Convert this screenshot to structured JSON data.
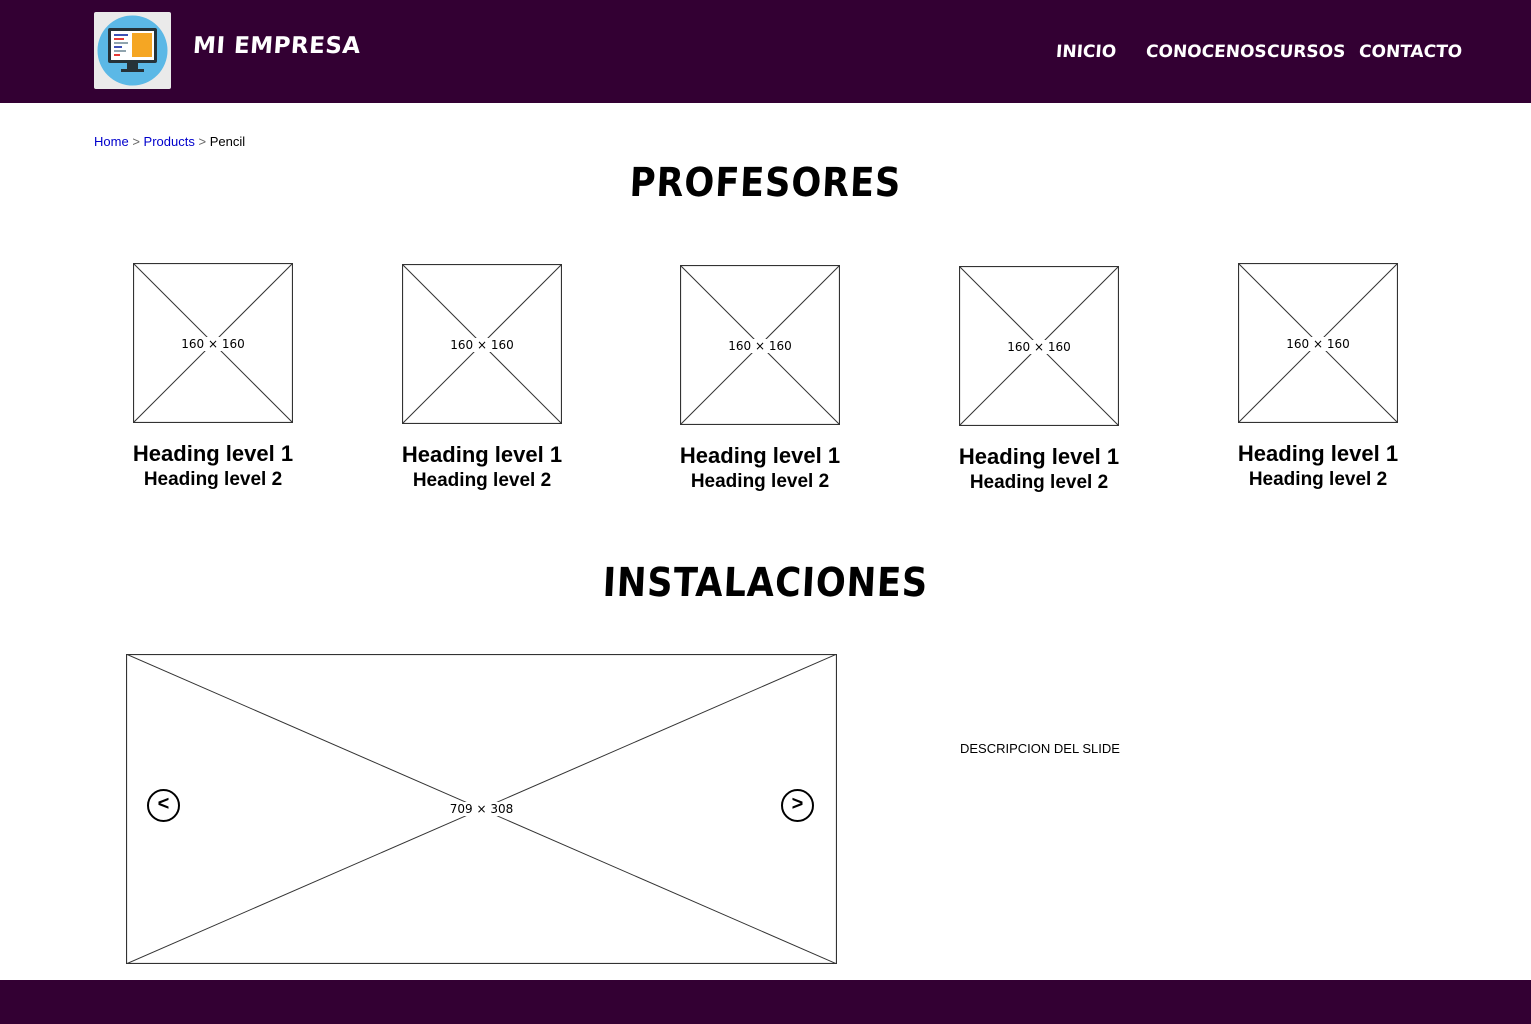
{
  "header": {
    "brand": "MI EMPRESA",
    "logo_icon": "monitor-icon",
    "background": "#330033",
    "nav": [
      {
        "label": "INICIO"
      },
      {
        "label": "CONOCENOS"
      },
      {
        "label": "CURSOS"
      },
      {
        "label": "CONTACTO"
      }
    ]
  },
  "breadcrumb": {
    "items": [
      "Home",
      "Products",
      "Pencil"
    ],
    "separator": ">"
  },
  "profesores": {
    "title": "PROFESORES",
    "cards": [
      {
        "placeholder": "160 × 160",
        "heading1": "Heading level 1",
        "heading2": "Heading level 2"
      },
      {
        "placeholder": "160 × 160",
        "heading1": "Heading level 1",
        "heading2": "Heading level 2"
      },
      {
        "placeholder": "160 × 160",
        "heading1": "Heading level 1",
        "heading2": "Heading level 2"
      },
      {
        "placeholder": "160 × 160",
        "heading1": "Heading level 1",
        "heading2": "Heading level 2"
      },
      {
        "placeholder": "160 × 160",
        "heading1": "Heading level 1",
        "heading2": "Heading level 2"
      }
    ]
  },
  "instalaciones": {
    "title": "INSTALACIONES",
    "slide_placeholder": "709 × 308",
    "prev_label": "<",
    "next_label": ">",
    "description": "DESCRIPCION DEL SLIDE"
  },
  "footer": {
    "background": "#330033"
  }
}
